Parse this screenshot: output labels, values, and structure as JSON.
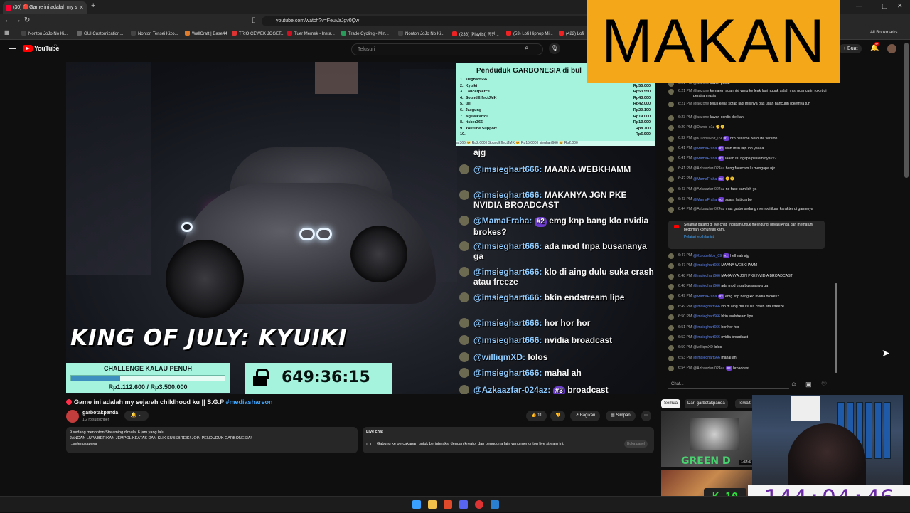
{
  "browser": {
    "tab_title": "(30) 🔴Game ini adalah my s",
    "url": "youtube.com/watch?v=FeuVaJgv0Qw",
    "bookmarks": [
      {
        "label": "Nonton JoJo No Ki...",
        "color": "#444"
      },
      {
        "label": "GUI Customization...",
        "color": "#666"
      },
      {
        "label": "Nonton Tensei Kizo...",
        "color": "#444"
      },
      {
        "label": "WallCraft | Base44",
        "color": "#e07b2a"
      },
      {
        "label": "TRIO CEWEK JOGET...",
        "color": "#d33"
      },
      {
        "label": "Tuer Memek - Insta...",
        "color": "#c12"
      },
      {
        "label": "Trade Cycling - Min...",
        "color": "#2a9a5a"
      },
      {
        "label": "Nonton JoJo No Ki...",
        "color": "#444"
      },
      {
        "label": "(236) [Playlist] 동진...",
        "color": "#e22"
      },
      {
        "label": "(53) Lofi Hiphop Mi...",
        "color": "#e22"
      },
      {
        "label": "(422) Lofi",
        "color": "#e22"
      }
    ],
    "all_bookmarks": "All Bookmarks"
  },
  "youtube": {
    "logo": "YouTube",
    "logo_region": "ID",
    "search_placeholder": "Telusuri",
    "create_label": "Buat",
    "notif_count": "9+"
  },
  "overlay": {
    "king_text": "KING OF JULY: KYUIKI",
    "challenge_title": "CHALLENGE KALAU PENUH",
    "challenge_value": "Rp1.112.600 / Rp3.500.000",
    "challenge_progress": 0.318,
    "timer": "649:36:15",
    "leaderboard_title": "Penduduk GARBONESIA di bul",
    "leaderboard": [
      {
        "rank": "1.",
        "name": "sieghart666",
        "amount": "Rp78.600"
      },
      {
        "rank": "2.",
        "name": "Kyuiki",
        "amount": "Rp55.000"
      },
      {
        "rank": "3.",
        "name": "Lancerpierce",
        "amount": "Rp53.550"
      },
      {
        "rank": "4.",
        "name": "SoundEffectJMK",
        "amount": "Rp43.000"
      },
      {
        "rank": "5.",
        "name": "uri",
        "amount": "Rp42.000"
      },
      {
        "rank": "6.",
        "name": "Jaegung",
        "amount": "Rp20.100"
      },
      {
        "rank": "7.",
        "name": "Ngewikartol",
        "amount": "Rp19.000"
      },
      {
        "rank": "8.",
        "name": "risber366",
        "amount": "Rp13.000"
      },
      {
        "rank": "9.",
        "name": "Youtube Support",
        "amount": "Rp8.700"
      },
      {
        "rank": "10.",
        "name": "",
        "amount": "Rp6.000"
      }
    ],
    "ticker": "ar366 🐱 Rp2.000 | SoundEffectJMK 🐱 Rp15.000 | sieghart666 🐱 Rp2.000",
    "chat": [
      {
        "name": "",
        "text": "ajg"
      },
      {
        "name": "@imsieghart666:",
        "text": "MAANA WEBKHAMM"
      },
      {
        "name": "@imsieghart666:",
        "text": "MAKANYA JGN PKE NVIDIA BROADCAST"
      },
      {
        "name": "@MamaFraha:",
        "badge": "#2",
        "text": "emg knp bang klo nvidia brokes?"
      },
      {
        "name": "@imsieghart666:",
        "text": "ada mod tnpa busananya ga"
      },
      {
        "name": "@imsieghart666:",
        "text": "klo di aing dulu suka crash atau freeze"
      },
      {
        "name": "@imsieghart666:",
        "text": "bkin endstream lipe"
      },
      {
        "name": "@imsieghart666:",
        "text": "hor hor hor"
      },
      {
        "name": "@imsieghart666:",
        "text": "nvidia broadcast"
      },
      {
        "name": "@williqmXD:",
        "text": "lolos"
      },
      {
        "name": "@imsieghart666:",
        "text": "mahal ah"
      },
      {
        "name": "@Azkaazfar-024az:",
        "badge": "#3",
        "text": "broadcast"
      }
    ]
  },
  "video": {
    "title": "Game ini adalah my sejarah childhood ku || S.G.P",
    "hashtag": "#mediashareon",
    "channel": "garbotakpanda",
    "subscribers": "1,2 rb subscriber",
    "likes": "11",
    "share": "Bagikan",
    "save": "Simpan",
    "desc_stats": "9 sedang menonton  Streaming dimulai 6 jam yang lalu",
    "desc_text": "JANGAN LUPA BERIKAN JEMPOL KEATAS DAN KLIK SUBSBREIK! JOIN PENDUDUK GARBONESIA!!",
    "desc_more": "...selengkapnya",
    "livechat_label": "Live chat",
    "livechat_join": "Gabung ke percakapan untuk berinteraksi dengan kreator dan pengguna lain yang menonton live stream ini.",
    "livechat_btn": "Buka panel"
  },
  "chatpanel": {
    "messages": [
      {
        "time": "6:21 PM",
        "author": "@aozone",
        "text": "lawan pusat"
      },
      {
        "time": "6:21 PM",
        "author": "@aozone",
        "text": "kemaren ada misi yang ke leak lagi nggak salah misi ngancurin roket di perairan rusia"
      },
      {
        "time": "6:21 PM",
        "author": "@aozone",
        "text": "terus kena scrap lagi misinya pas udah hancurin roketnya tuh"
      },
      {
        "time": "6:23 PM",
        "author": "@aozone",
        "text": "lawan cordis die kan"
      },
      {
        "time": "6:29 PM",
        "author": "@Dambi-x1z",
        "text": "🫠🫠"
      },
      {
        "time": "6:32 PM",
        "author": "@KurobeNoir_09",
        "badge": "#1",
        "text": "bro became Nero lite version"
      },
      {
        "time": "6:41 PM",
        "author": "@MamaFraha",
        "badge": "#2",
        "text": "wah msh lajn loh yaaaa",
        "mod": true
      },
      {
        "time": "6:41 PM",
        "author": "@MamaFraha",
        "badge": "#2",
        "text": "laaah itu ngapa peslem nya???",
        "mod": true
      },
      {
        "time": "6:41 PM",
        "author": "@Azkaazfar-024az",
        "text": "bang facecam lu mengapa njir"
      },
      {
        "time": "6:42 PM",
        "author": "@MamaFraha",
        "badge": "#2",
        "text": "🫠🫠",
        "mod": true
      },
      {
        "time": "6:43 PM",
        "author": "@Azkaazfar-024az",
        "text": "no face cam loh ya"
      },
      {
        "time": "6:43 PM",
        "author": "@MamaFraha",
        "badge": "#2",
        "text": "suara hati garbo",
        "mod": true
      },
      {
        "time": "6:44 PM",
        "author": "@Azkaazfar-024az",
        "text": "mas garbo sedang memodifikasi karakter di gamenya"
      }
    ],
    "notice": "Selamat datang di live chat! Ingatlah untuk melindungi privasi Anda dan mematuhi pedoman komunitas kami.",
    "notice_link": "Pelajari lebih lanjut",
    "messages2": [
      {
        "time": "6:47 PM",
        "author": "@KurobeNoir_09",
        "badge": "#1",
        "text": "hell nah ajg",
        "mod": true
      },
      {
        "time": "6:47 PM",
        "author": "@imsieghart666",
        "text": "MAANA WEBKHAMM",
        "mod": true
      },
      {
        "time": "6:48 PM",
        "author": "@imsieghart666",
        "text": "MAKANYA JGN PKE NVIDIA BROADCAST",
        "mod": true
      },
      {
        "time": "6:48 PM",
        "author": "@imsieghart666",
        "text": "ada mod tnpa busananya ga",
        "mod": true
      },
      {
        "time": "6:49 PM",
        "author": "@MamaFraha",
        "badge": "#2",
        "text": "emg knp bang klo nvidia brokes?",
        "mod": true
      },
      {
        "time": "6:49 PM",
        "author": "@imsieghart666",
        "text": "klo di aing dulu suka crash atau freeze",
        "mod": true
      },
      {
        "time": "6:50 PM",
        "author": "@imsieghart666",
        "text": "bkin endstream lipe",
        "mod": true
      },
      {
        "time": "6:51 PM",
        "author": "@imsieghart666",
        "text": "hor hor hor",
        "mod": true
      },
      {
        "time": "6:52 PM",
        "author": "@imsieghart666",
        "text": "nvidia broadcast",
        "mod": true
      },
      {
        "time": "6:50 PM",
        "author": "@williqmXD",
        "text": "lolos"
      },
      {
        "time": "6:53 PM",
        "author": "@imsieghart666",
        "text": "mahal ah",
        "mod": true
      },
      {
        "time": "6:54 PM",
        "author": "@Azkaazfar-024az",
        "badge": "#3",
        "text": "broadcast"
      }
    ],
    "input_placeholder": "Chat..."
  },
  "filters": [
    "Semua",
    "Dari garbotakpanda",
    "Terkait"
  ],
  "recommended": {
    "thumb_text": "GREEN D",
    "duration": "1:54:5"
  },
  "banner": "MAKAN",
  "big_timer": "144:04:46",
  "k_counter": "10"
}
